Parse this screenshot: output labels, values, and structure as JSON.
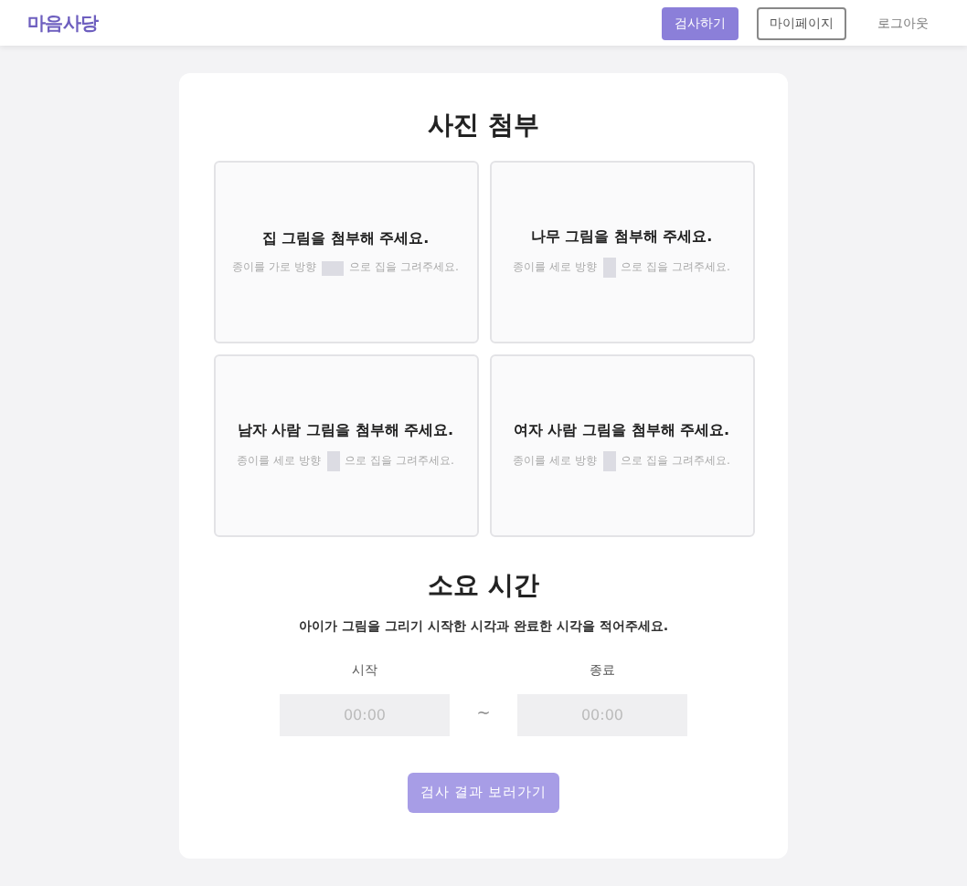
{
  "header": {
    "logo": "마음사당",
    "nav": [
      {
        "label": "검사하기",
        "kind": "primary"
      },
      {
        "label": "마이페이지",
        "kind": "outline"
      },
      {
        "label": "로그아웃",
        "kind": "text"
      }
    ]
  },
  "attach": {
    "title": "사진 첨부",
    "slots": [
      {
        "title": "집 그림을 첨부해 주세요.",
        "hint_before": "종이를 가로 방향",
        "hint_after": "으로 집을 그려주세요.",
        "kind": "landscape"
      },
      {
        "title": "나무 그림을 첨부해 주세요.",
        "hint_before": "종이를 세로 방향",
        "hint_after": "으로 집을 그려주세요.",
        "kind": "portrait"
      },
      {
        "title": "남자 사람 그림을 첨부해 주세요.",
        "hint_before": "종이를 세로 방향",
        "hint_after": "으로 집을 그려주세요.",
        "kind": "portrait"
      },
      {
        "title": "여자 사람 그림을 첨부해 주세요.",
        "hint_before": "종이를 세로 방향",
        "hint_after": "으로 집을 그려주세요.",
        "kind": "portrait"
      }
    ]
  },
  "time": {
    "title": "소요 시간",
    "description": "아이가 그림을 그리기 시작한 시각과 완료한 시각을 적어주세요.",
    "start": {
      "label": "시작",
      "placeholder": "00:00"
    },
    "separator": "~",
    "end": {
      "label": "종료",
      "placeholder": "00:00"
    }
  },
  "submit": {
    "label": "검사 결과 보러가기",
    "disabled": true
  }
}
